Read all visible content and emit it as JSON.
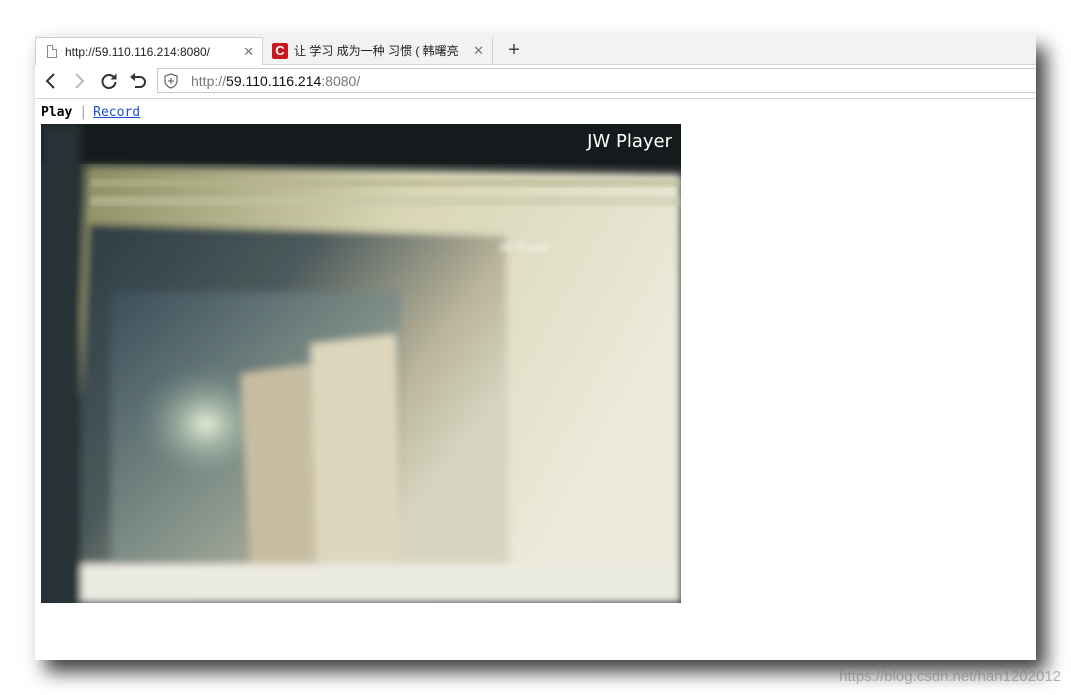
{
  "tabs": [
    {
      "title": "http://59.110.116.214:8080/",
      "icon": "page-icon",
      "active": true
    },
    {
      "title": "让 学习 成为一种 习惯 ( 韩曙亮",
      "icon": "csdn-logo-icon",
      "active": false
    }
  ],
  "new_tab_label": "+",
  "address": {
    "scheme": "http://",
    "host": "59.110.116.214",
    "rest": ":8080/"
  },
  "nav": {
    "play_label": "Play",
    "separator": "|",
    "record_label": "Record"
  },
  "player": {
    "brand": "JW Player",
    "inner_brand": "JW Player"
  },
  "watermark": "https://blog.csdn.net/han1202012",
  "colors": {
    "tab_bg": "#f2f2f2",
    "link": "#1a4fd6",
    "csdn_red": "#c9181d"
  }
}
